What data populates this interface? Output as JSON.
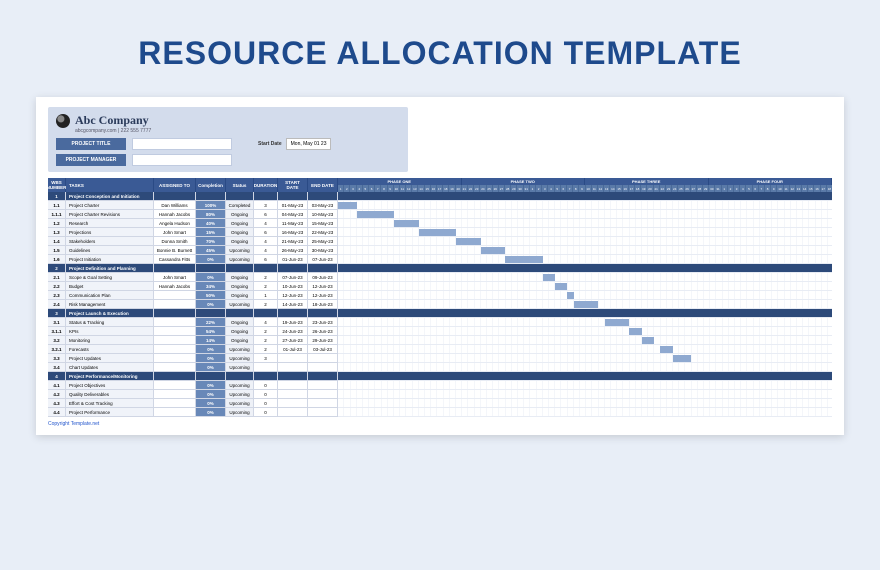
{
  "title": "RESOURCE ALLOCATION TEMPLATE",
  "company": {
    "name": "Abc Company",
    "sub": "abcgcompany.com | 222 555 7777"
  },
  "meta": {
    "project_title_label": "PROJECT TITLE",
    "project_manager_label": "PROJECT MANAGER",
    "start_date_label": "Start Date",
    "start_date_value": "Mon, May 01 23"
  },
  "columns": {
    "wbs": "WBS NUMBER",
    "tasks": "TASKS",
    "assigned": "ASSIGNED TO",
    "completion": "Completion",
    "status": "Status",
    "duration": "DURATION",
    "start": "START DATE",
    "end": "END DATE"
  },
  "phases_header": [
    "PHASE ONE",
    "PHASE TWO",
    "PHASE THREE",
    "PHASE FOUR"
  ],
  "rows": [
    {
      "type": "phase",
      "wbs": "1",
      "task": "Project Conception and Initiation"
    },
    {
      "type": "task",
      "wbs": "1.1",
      "task": "Project Charter",
      "assigned": "Dan Williams",
      "comp": "100%",
      "status": "Completed",
      "dur": "3",
      "start": "01-May-23",
      "end": "03-May-23",
      "bar": [
        0,
        3
      ]
    },
    {
      "type": "task",
      "wbs": "1.1.1",
      "task": "Project Charter Revisions",
      "assigned": "Hannah Jacobs",
      "comp": "80%",
      "status": "Ongoing",
      "dur": "6",
      "start": "04-May-23",
      "end": "10-May-23",
      "bar": [
        3,
        6
      ]
    },
    {
      "type": "task",
      "wbs": "1.2",
      "task": "Research",
      "assigned": "Angela Hudson",
      "comp": "40%",
      "status": "Ongoing",
      "dur": "4",
      "start": "11-May-23",
      "end": "15-May-23",
      "bar": [
        9,
        4
      ]
    },
    {
      "type": "task",
      "wbs": "1.3",
      "task": "Projections",
      "assigned": "John Smart",
      "comp": "15%",
      "status": "Ongoing",
      "dur": "6",
      "start": "16-May-23",
      "end": "22-May-23",
      "bar": [
        13,
        6
      ]
    },
    {
      "type": "task",
      "wbs": "1.4",
      "task": "Stakeholders",
      "assigned": "Donna Smith",
      "comp": "70%",
      "status": "Ongoing",
      "dur": "4",
      "start": "21-May-23",
      "end": "25-May-23",
      "bar": [
        19,
        4
      ]
    },
    {
      "type": "task",
      "wbs": "1.5",
      "task": "Guidelines",
      "assigned": "Bonnie B. Burnett",
      "comp": "45%",
      "status": "Upcoming",
      "dur": "4",
      "start": "26-May-23",
      "end": "30-May-23",
      "bar": [
        23,
        4
      ]
    },
    {
      "type": "task",
      "wbs": "1.6",
      "task": "Project Initiation",
      "assigned": "Cassandra Fitts",
      "comp": "0%",
      "status": "Upcoming",
      "dur": "6",
      "start": "01-Jun-23",
      "end": "07-Jun-23",
      "bar": [
        27,
        6
      ]
    },
    {
      "type": "phase",
      "wbs": "2",
      "task": "Project Definition and Planning"
    },
    {
      "type": "task",
      "wbs": "2.1",
      "task": "Scope & Goal Setting",
      "assigned": "John Smart",
      "comp": "0%",
      "status": "Ongoing",
      "dur": "2",
      "start": "07-Jun-23",
      "end": "09-Jun-23",
      "bar": [
        33,
        2
      ]
    },
    {
      "type": "task",
      "wbs": "2.2",
      "task": "Budget",
      "assigned": "Hannah Jacobs",
      "comp": "34%",
      "status": "Ongoing",
      "dur": "2",
      "start": "10-Jun-23",
      "end": "12-Jun-23",
      "bar": [
        35,
        2
      ]
    },
    {
      "type": "task",
      "wbs": "2.3",
      "task": "Communication Plan",
      "assigned": "",
      "comp": "50%",
      "status": "Ongoing",
      "dur": "1",
      "start": "12-Jun-23",
      "end": "12-Jun-23",
      "bar": [
        37,
        1
      ]
    },
    {
      "type": "task",
      "wbs": "2.4",
      "task": "Risk Management",
      "assigned": "",
      "comp": "0%",
      "status": "Upcoming",
      "dur": "2",
      "start": "14-Jun-23",
      "end": "18-Jun-23",
      "bar": [
        38,
        4
      ]
    },
    {
      "type": "phase",
      "wbs": "3",
      "task": "Project Launch & Execution"
    },
    {
      "type": "task",
      "wbs": "3.1",
      "task": "Status & Tracking",
      "assigned": "",
      "comp": "22%",
      "status": "Ongoing",
      "dur": "4",
      "start": "19-Jun-23",
      "end": "23-Jun-23",
      "bar": [
        43,
        4
      ]
    },
    {
      "type": "task",
      "wbs": "3.1.1",
      "task": "KPIs",
      "assigned": "",
      "comp": "54%",
      "status": "Ongoing",
      "dur": "2",
      "start": "24-Jun-23",
      "end": "26-Jun-23",
      "bar": [
        47,
        2
      ]
    },
    {
      "type": "task",
      "wbs": "3.2",
      "task": "Monitoring",
      "assigned": "",
      "comp": "14%",
      "status": "Ongoing",
      "dur": "2",
      "start": "27-Jun-23",
      "end": "29-Jun-23",
      "bar": [
        49,
        2
      ]
    },
    {
      "type": "task",
      "wbs": "3.2.1",
      "task": "Forecasts",
      "assigned": "",
      "comp": "0%",
      "status": "Upcoming",
      "dur": "2",
      "start": "01-Jul-23",
      "end": "03-Jul-23",
      "bar": [
        52,
        2
      ]
    },
    {
      "type": "task",
      "wbs": "3.3",
      "task": "Project Updates",
      "assigned": "",
      "comp": "0%",
      "status": "Upcoming",
      "dur": "3",
      "start": "",
      "end": "",
      "bar": [
        54,
        3
      ]
    },
    {
      "type": "task",
      "wbs": "3.4",
      "task": "Chart Updates",
      "assigned": "",
      "comp": "0%",
      "status": "Upcoming",
      "dur": "",
      "start": "",
      "end": ""
    },
    {
      "type": "phase",
      "wbs": "4",
      "task": "Project Performance/Monitoring"
    },
    {
      "type": "task",
      "wbs": "4.1",
      "task": "Project Objectives",
      "assigned": "",
      "comp": "0%",
      "status": "Upcoming",
      "dur": "0",
      "start": "",
      "end": ""
    },
    {
      "type": "task",
      "wbs": "4.2",
      "task": "Quality Deliverables",
      "assigned": "",
      "comp": "0%",
      "status": "Upcoming",
      "dur": "0",
      "start": "",
      "end": ""
    },
    {
      "type": "task",
      "wbs": "4.3",
      "task": "Effort & Cost Tracking",
      "assigned": "",
      "comp": "0%",
      "status": "Upcoming",
      "dur": "0",
      "start": "",
      "end": ""
    },
    {
      "type": "task",
      "wbs": "4.4",
      "task": "Project Performance",
      "assigned": "",
      "comp": "0%",
      "status": "Upcoming",
      "dur": "0",
      "start": "",
      "end": ""
    }
  ],
  "footer": "Copyright Template.net"
}
